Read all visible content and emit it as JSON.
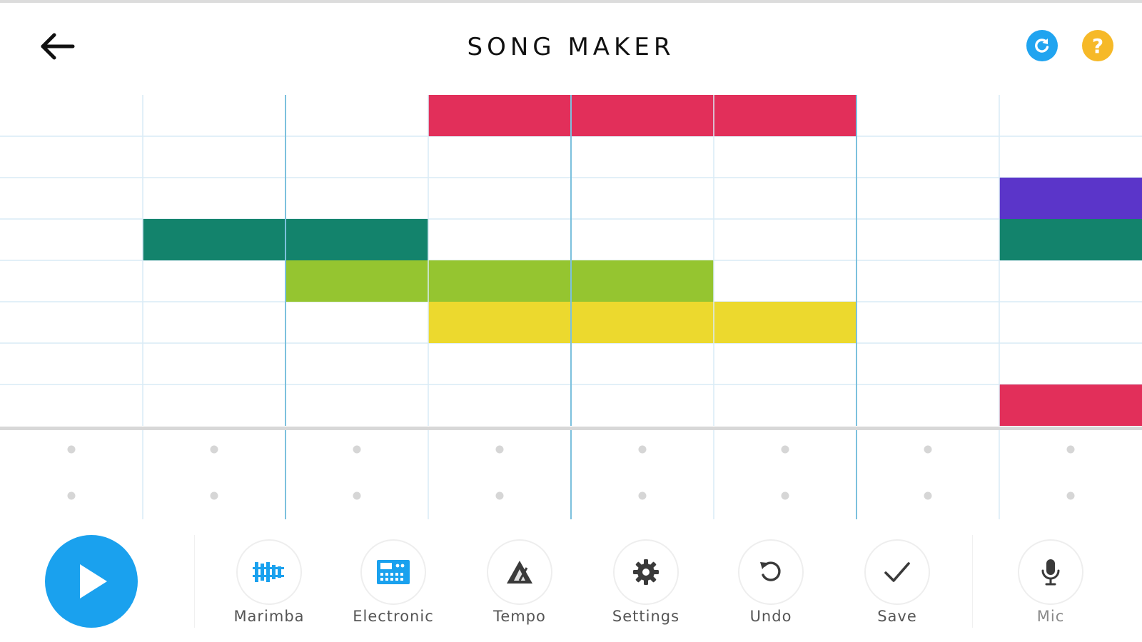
{
  "header": {
    "title": "SONG MAKER",
    "back_icon": "back-arrow-icon",
    "refresh_icon": "refresh-icon",
    "help_icon": "help-icon",
    "help_glyph": "?"
  },
  "grid": {
    "columns": 8,
    "melody_rows": 8,
    "bar_every": 2,
    "notes": [
      {
        "row": 0,
        "col_start": 3,
        "col_end": 6,
        "color": "#e22f5a"
      },
      {
        "row": 2,
        "col_start": 7,
        "col_end": 8,
        "color": "#5b35c9"
      },
      {
        "row": 3,
        "col_start": 1,
        "col_end": 3,
        "color": "#13836c"
      },
      {
        "row": 3,
        "col_start": 7,
        "col_end": 8,
        "color": "#13836c"
      },
      {
        "row": 4,
        "col_start": 2,
        "col_end": 5,
        "color": "#95c530"
      },
      {
        "row": 5,
        "col_start": 3,
        "col_end": 6,
        "color": "#ecd92e"
      },
      {
        "row": 7,
        "col_start": 7,
        "col_end": 8,
        "color": "#e22f5a"
      }
    ],
    "percussion_rows": 2
  },
  "colors": {
    "accent_blue": "#1aa1ee",
    "help_yellow": "#f6b928",
    "grid_line": "#d9ebf6",
    "bar_line": "#7cc1dd",
    "dot": "#d6d6d6"
  },
  "toolbar": {
    "play_icon": "play-icon",
    "tools": [
      {
        "label": "Marimba",
        "icon": "marimba-icon"
      },
      {
        "label": "Electronic",
        "icon": "electronic-icon"
      },
      {
        "label": "Tempo",
        "icon": "tempo-icon"
      },
      {
        "label": "Settings",
        "icon": "gear-icon"
      },
      {
        "label": "Undo",
        "icon": "undo-icon"
      },
      {
        "label": "Save",
        "icon": "check-icon"
      },
      {
        "label": "Mic",
        "icon": "mic-icon"
      }
    ]
  }
}
